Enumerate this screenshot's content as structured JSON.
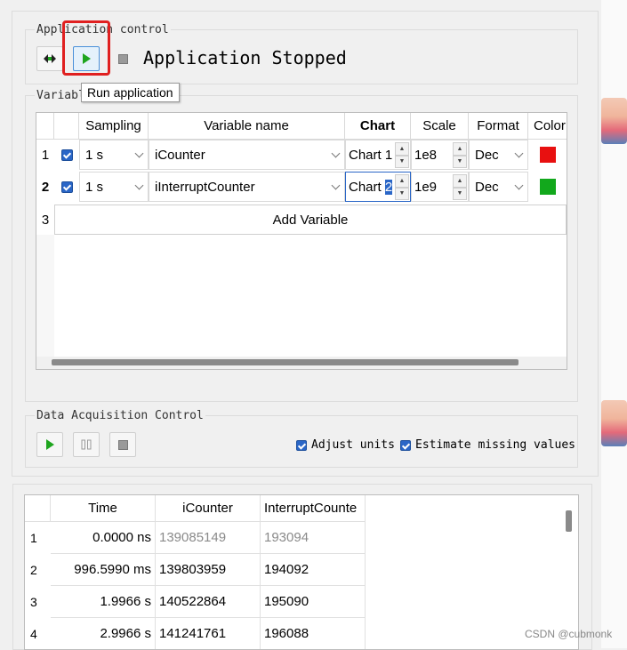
{
  "app_control": {
    "title": "Application control",
    "status": "Application Stopped",
    "tooltip": "Run application"
  },
  "variables": {
    "title": "Variabl",
    "headers": [
      "Sampling",
      "Variable name",
      "Chart",
      "Scale",
      "Format",
      "Color"
    ],
    "rows": [
      {
        "num": "1",
        "sampling": "1 s",
        "name": "iCounter",
        "chart": "Chart 1",
        "scale": "1e8",
        "format": "Dec",
        "color": "#e81010"
      },
      {
        "num": "2",
        "sampling": "1 s",
        "name": "iInterruptCounter",
        "chart_prefix": "Chart ",
        "chart_sel": "2",
        "scale": "1e9",
        "format": "Dec",
        "color": "#12a81c"
      }
    ],
    "add_row_num": "3",
    "add_label": "Add Variable"
  },
  "acquisition": {
    "title": "Data Acquisition Control",
    "adjust_units": "Adjust units",
    "estimate_missing": "Estimate missing values"
  },
  "data_table": {
    "headers": [
      "Time",
      "iCounter",
      "InterruptCounte"
    ],
    "rows": [
      {
        "num": "1",
        "time": "0.0000 ns",
        "icounter": "139085149",
        "interrupt": "193094"
      },
      {
        "num": "2",
        "time": "996.5990 ms",
        "icounter": "139803959",
        "interrupt": "194092"
      },
      {
        "num": "3",
        "time": "1.9966 s",
        "icounter": "140522864",
        "interrupt": "195090"
      },
      {
        "num": "4",
        "time": "2.9966 s",
        "icounter": "141241761",
        "interrupt": "196088"
      }
    ]
  },
  "watermark": "CSDN @cubmonk",
  "colors": {
    "highlight": "#e02020",
    "accent": "#2a66c7",
    "run_green": "#1ea51e"
  }
}
